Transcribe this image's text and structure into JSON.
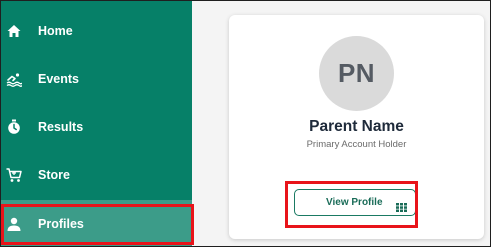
{
  "sidebar": {
    "items": [
      {
        "label": "Home",
        "icon": "home-icon"
      },
      {
        "label": "Events",
        "icon": "swimmer-icon"
      },
      {
        "label": "Results",
        "icon": "stopwatch-icon"
      },
      {
        "label": "Store",
        "icon": "cart-icon"
      },
      {
        "label": "Profiles",
        "icon": "person-icon",
        "active": true
      }
    ],
    "background": "#068068"
  },
  "profile_card": {
    "initials": "PN",
    "name": "Parent Name",
    "role": "Primary Account Holder",
    "view_button_label": "View Profile",
    "view_button_icon": "grid-icon"
  },
  "colors": {
    "accent": "#068068",
    "highlight": "#e8141a",
    "avatar_bg": "#dadada",
    "name_text": "#1e2a3a"
  }
}
